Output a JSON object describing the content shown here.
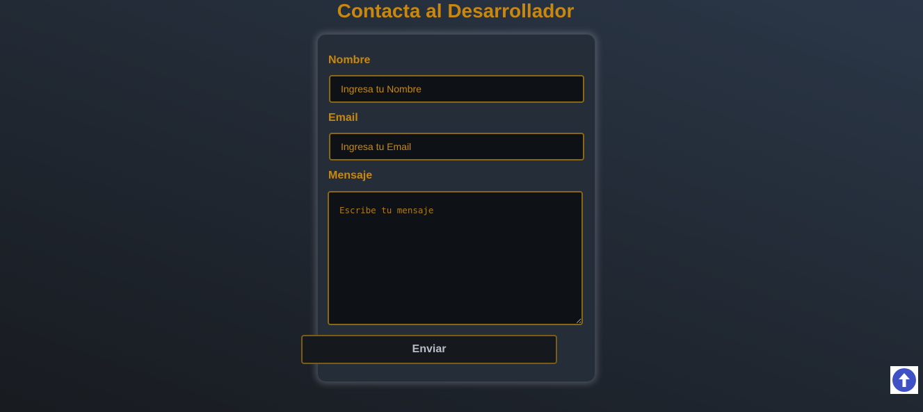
{
  "page": {
    "title": "Contacta al Desarrollador"
  },
  "form": {
    "name_label": "Nombre",
    "name_placeholder": "Ingresa tu Nombre",
    "name_value": "",
    "email_label": "Email",
    "email_placeholder": "Ingresa tu Email",
    "email_value": "",
    "message_label": "Mensaje",
    "message_placeholder": "Escribe tu mensaje",
    "message_value": "",
    "submit_label": "Enviar"
  },
  "scroll_top": {
    "icon": "arrow-up-icon"
  },
  "colors": {
    "accent": "#c8880f",
    "card_background": "#252d38",
    "input_background": "#0e1217",
    "scroll_button": "#3f51c4"
  }
}
